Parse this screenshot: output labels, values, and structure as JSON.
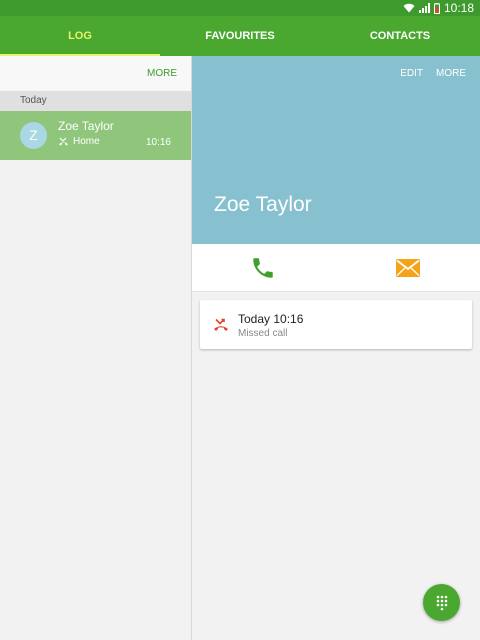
{
  "status_bar": {
    "time": "10:18"
  },
  "tabs": [
    {
      "label": "LOG",
      "active": true
    },
    {
      "label": "FAVOURITES",
      "active": false
    },
    {
      "label": "CONTACTS",
      "active": false
    }
  ],
  "log_pane": {
    "more_label": "MORE",
    "section_header": "Today",
    "items": [
      {
        "avatar_letter": "Z",
        "name": "Zoe Taylor",
        "type": "Home",
        "time": "10:16"
      }
    ]
  },
  "contact_detail": {
    "edit_label": "EDIT",
    "more_label": "MORE",
    "name": "Zoe Taylor",
    "call_log": [
      {
        "title": "Today 10:16",
        "subtitle": "Missed call"
      }
    ]
  },
  "colors": {
    "status_bar": "#3f9a2e",
    "tab_bar": "#4aa831",
    "active_tab": "#e8f36a",
    "selected_item": "#8fc67c",
    "contact_header": "#87c1cf",
    "call_icon": "#3fa12c",
    "message_icon": "#f4a41b",
    "missed_call_icon": "#e2432a"
  },
  "icons": {
    "call": "phone-icon",
    "message": "envelope-icon",
    "missed": "missed-call-icon",
    "dialpad": "dialpad-icon"
  }
}
